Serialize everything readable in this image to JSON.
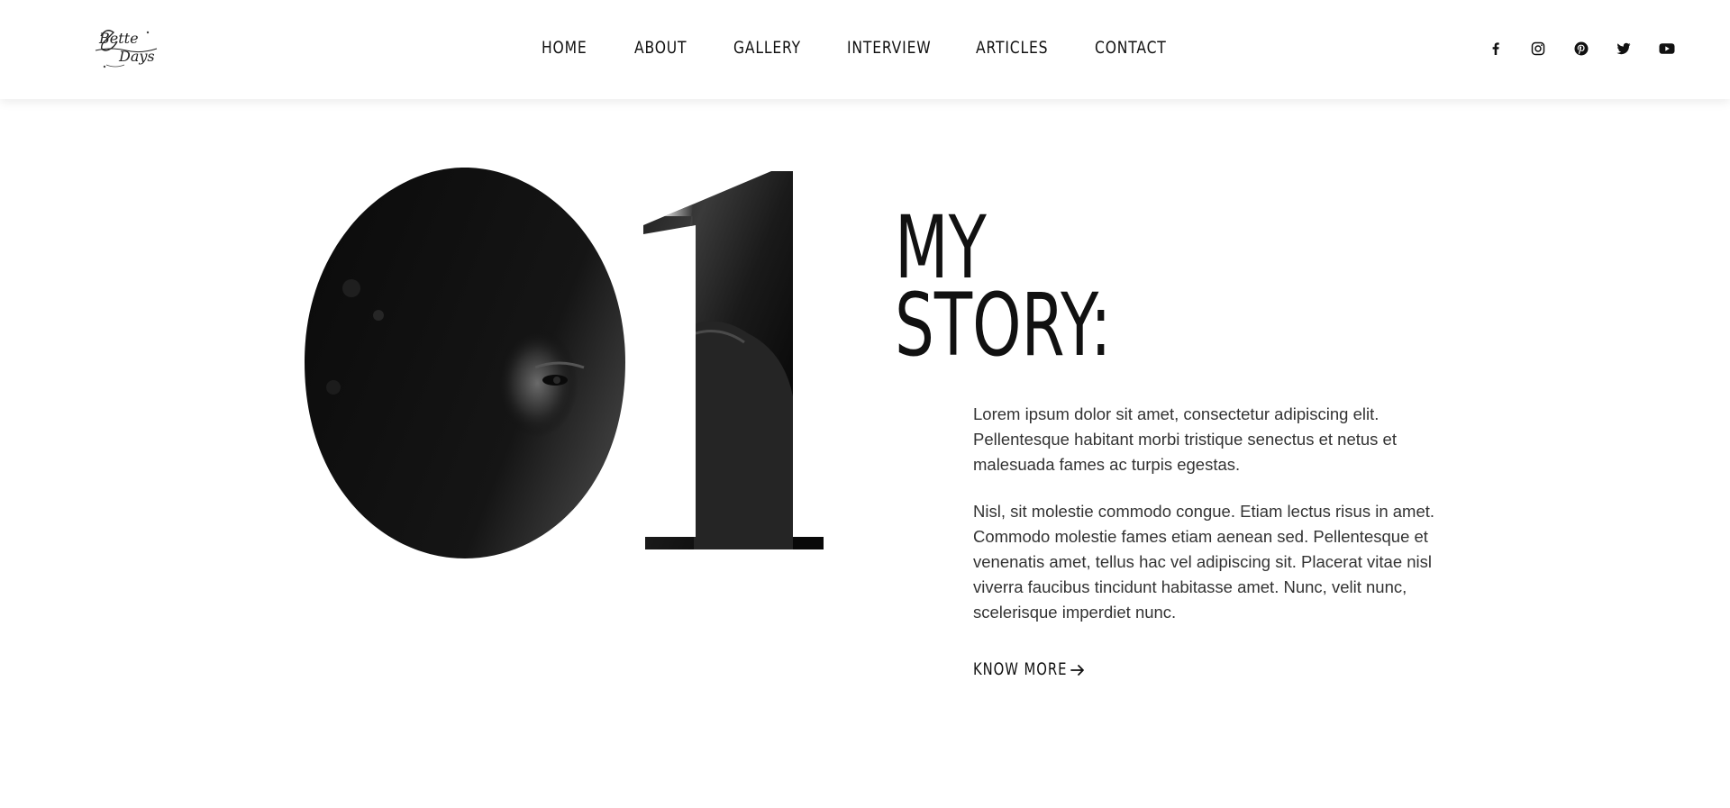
{
  "header": {
    "logo_text": "Better Days",
    "nav": [
      {
        "label": "HOME"
      },
      {
        "label": "ABOUT"
      },
      {
        "label": "GALLERY"
      },
      {
        "label": "INTERVIEW"
      },
      {
        "label": "ARTICLES"
      },
      {
        "label": "CONTACT"
      }
    ],
    "social_icons": [
      "facebook-icon",
      "instagram-icon",
      "pinterest-icon",
      "twitter-icon",
      "youtube-icon"
    ]
  },
  "hero": {
    "number": "01",
    "title_line1": "MY",
    "title_line2": "STORY:",
    "paragraph1": "Lorem ipsum dolor sit amet, consectetur adipiscing elit. Pellentesque habitant morbi tristique senectus et netus et malesuada fames ac turpis egestas.",
    "paragraph2": "Nisl, sit molestie commodo congue. Etiam lectus risus in amet. Commodo molestie fames etiam aenean sed. Pellentesque et venenatis amet, tellus hac vel adipiscing sit. Placerat vitae nisl viverra faucibus tincidunt habitasse amet. Nunc, velit nunc, scelerisque imperdiet nunc.",
    "cta_label": "KNOW MORE",
    "cta_icon": "arrow-right-icon"
  },
  "colors": {
    "text": "#111111",
    "body_text": "#333333",
    "background": "#ffffff"
  }
}
